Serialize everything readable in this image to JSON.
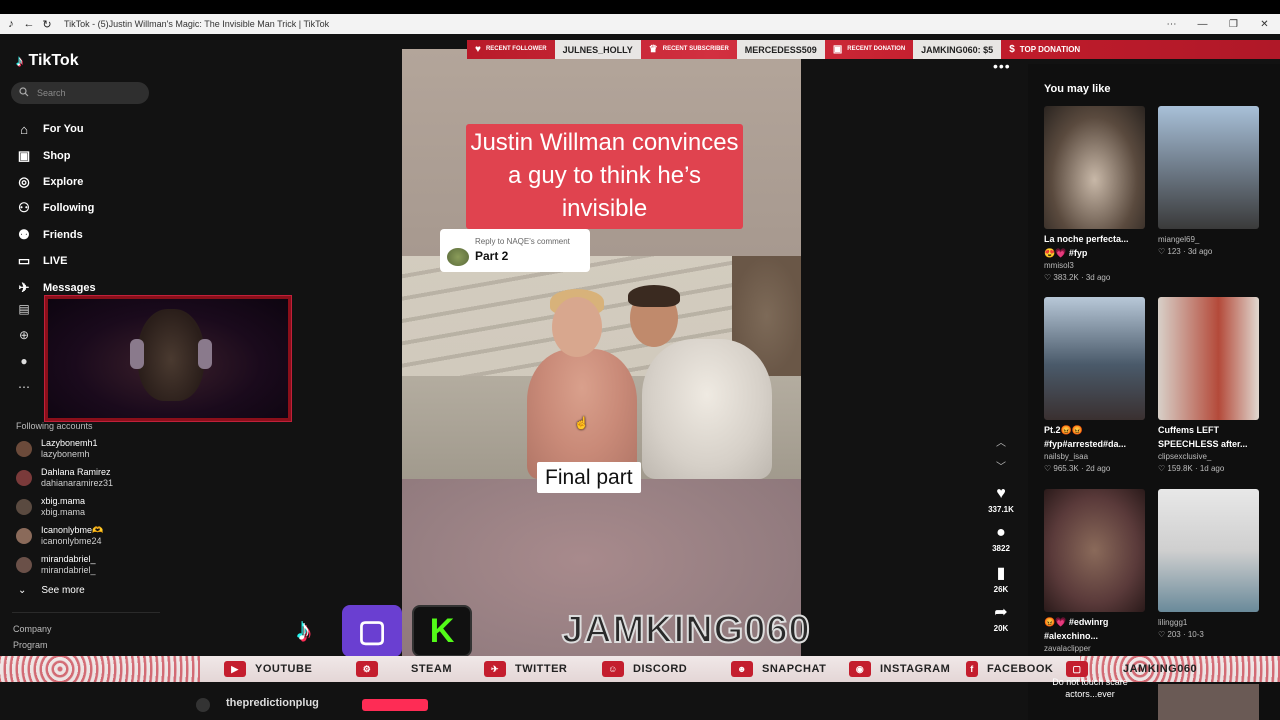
{
  "browser": {
    "title": "TikTok - (5)Justin Willman's Magic: The Invisible Man Trick | TikTok",
    "controls": [
      "⋯",
      "—",
      "❐",
      "✕"
    ]
  },
  "sidebar": {
    "logo_text": "TikTok",
    "search_placeholder": "Search",
    "nav": [
      {
        "label": "For You",
        "icon": "home-icon"
      },
      {
        "label": "Shop",
        "icon": "shop-icon"
      },
      {
        "label": "Explore",
        "icon": "compass-icon"
      },
      {
        "label": "Following",
        "icon": "following-icon"
      },
      {
        "label": "Friends",
        "icon": "friends-icon"
      },
      {
        "label": "LIVE",
        "icon": "live-icon"
      },
      {
        "label": "Messages",
        "icon": "messages-icon"
      }
    ],
    "following_header": "Following accounts",
    "accounts": [
      {
        "name": "Lazybonemh1",
        "handle": "lazybonemh"
      },
      {
        "name": "Dahlana Ramirez",
        "handle": "dahianaramirez31"
      },
      {
        "name": "xbig.mama",
        "handle": "xbig.mama"
      },
      {
        "name": "Icanonlybme🫶",
        "handle": "icanonlybme24"
      },
      {
        "name": "mirandabriel_",
        "handle": "mirandabriel_"
      }
    ],
    "see_more": "See more",
    "footer": [
      "Company",
      "Program"
    ]
  },
  "video": {
    "caption": "Justin Willman convinces a guy to think he’s invisible",
    "reply_to": "Reply to NAQE's comment",
    "reply_part": "Part 2",
    "final_label": "Final part"
  },
  "actions": {
    "likes": "337.1K",
    "comments": "3822",
    "saves": "26K",
    "shares": "20K"
  },
  "you_may_like": {
    "header": "You may like",
    "cards": [
      {
        "title": "La noche perfecta...",
        "title2": "😍💗 #fyp",
        "user": "mmisol3",
        "stats": "♡ 383.2K · 3d ago",
        "thumb_color": "#5a4a3e"
      },
      {
        "title": "",
        "title2": "",
        "user": "miangel69_",
        "stats": "♡ 123 · 3d ago",
        "thumb_color": "#6f7c8a"
      },
      {
        "title": "Pt.2😡😡",
        "title2": "#fyp#arrested#da...",
        "user": "nailsby_isaa",
        "stats": "♡ 965.3K · 2d ago",
        "thumb_color": "#4a5a6a"
      },
      {
        "title": "Cuffems LEFT",
        "title2": "SPEECHLESS after...",
        "user": "clipsexclusive_",
        "stats": "♡ 159.8K · 1d ago",
        "thumb_color": "#b44a3a"
      },
      {
        "title": "😡💗 #edwinrg",
        "title2": "#alexchino...",
        "user": "zavalaclipper",
        "stats": "",
        "thumb_color": "#5a3a3a"
      },
      {
        "title": "",
        "title2": "",
        "user": "lilinggg1",
        "stats": "♡ 203 · 10-3",
        "thumb_color": "#cfcfcf"
      }
    ],
    "bottom_text": "Do not touch scare actors...ever"
  },
  "overlay": {
    "alerts": [
      {
        "badge": "RECENT FOLLOWER",
        "name": "JULNES_HOLLY"
      },
      {
        "badge": "RECENT SUBSCRIBER",
        "name": "MERCEDESS509"
      },
      {
        "badge": "RECENT DONATION",
        "name": "JAMKING060: $5"
      },
      {
        "badge": "TOP DONATION",
        "name": ""
      }
    ],
    "streamer_name": "JAMKING060",
    "socials": [
      {
        "label": "YOUTUBE",
        "icon": "youtube-icon",
        "glyph": "▶"
      },
      {
        "label": "STEAM",
        "icon": "steam-icon",
        "glyph": "⚙"
      },
      {
        "label": "TWITTER",
        "icon": "twitter-icon",
        "glyph": "✈"
      },
      {
        "label": "DISCORD",
        "icon": "discord-icon",
        "glyph": "☺"
      },
      {
        "label": "SNAPCHAT",
        "icon": "snapchat-icon",
        "glyph": "☻"
      },
      {
        "label": "INSTAGRAM",
        "icon": "instagram-icon",
        "glyph": "◉"
      },
      {
        "label": "FACEBOOK",
        "icon": "facebook-icon",
        "glyph": "f"
      },
      {
        "label": "JAMKING060",
        "icon": "twitch-icon",
        "glyph": "▢"
      }
    ],
    "kick_letter": "K"
  },
  "bottom": {
    "prediction_user": "thepredictionplug"
  },
  "colors": {
    "accent": "#fe2c55",
    "caption_bg": "#e0434f",
    "overlay_red": "#c41e2e"
  }
}
